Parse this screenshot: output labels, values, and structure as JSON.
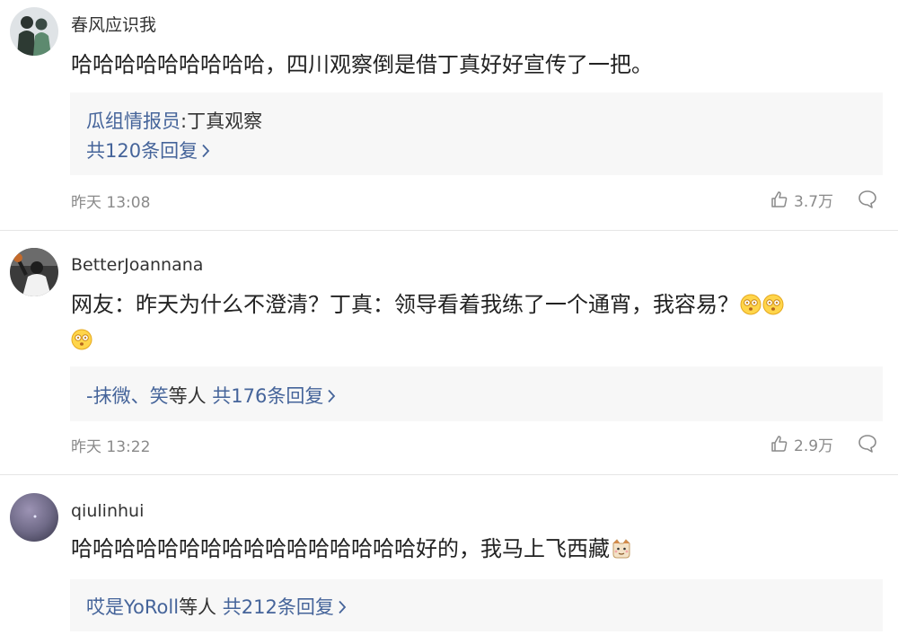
{
  "comments": [
    {
      "username": "春风应识我",
      "text": "哈哈哈哈哈哈哈哈哈，四川观察倒是借丁真好好宣传了一把。",
      "emojis": [],
      "replies": {
        "quote_author": "瓜组情报员",
        "quote_sep": ":",
        "quote_text": "丁真观察",
        "count_text": "共120条回复"
      },
      "time": "昨天 13:08",
      "likes": "3.7万"
    },
    {
      "username": "BetterJoannana",
      "text": "网友：昨天为什么不澄清？丁真：领导看着我练了一个通宵，我容易？",
      "emojis": [
        "dizzy-face-emoji",
        "dizzy-face-emoji",
        "dizzy-face-emoji"
      ],
      "replies": {
        "user1": "-抹微",
        "sep": "、",
        "user2": "笑",
        "suffix": "等人",
        "count_text": "共176条回复"
      },
      "time": "昨天 13:22",
      "likes": "2.9万"
    },
    {
      "username": "qiulinhui",
      "text": "哈哈哈哈哈哈哈哈哈哈哈哈哈哈哈哈好的，我马上飞西藏",
      "emojis": [
        "cat-emoji"
      ],
      "replies": {
        "user1": "哎是YoRoll",
        "suffix": "等人",
        "count_text": "共212条回复"
      }
    }
  ],
  "colors": {
    "link": "#45649a",
    "muted": "#8a8a8a",
    "reply_bg": "#f7f7f7",
    "divider": "#e6e6e6"
  },
  "icons": [
    "thumbs-up-icon",
    "comment-bubble-icon",
    "chevron-right-icon"
  ]
}
